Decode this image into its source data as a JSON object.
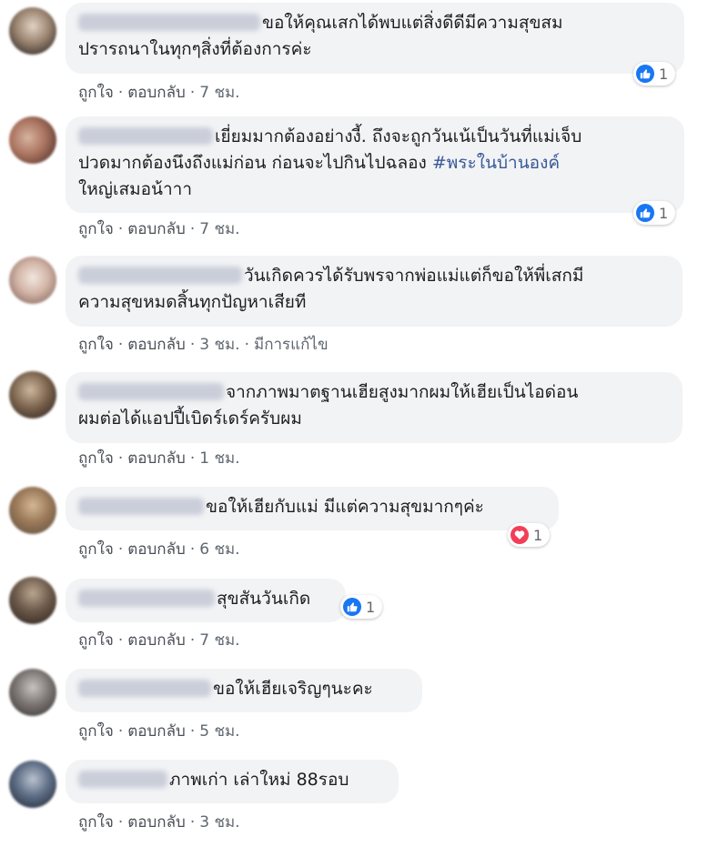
{
  "comments": [
    {
      "name_blur_width": 200,
      "text_lines": [
        "ขอให้คุณเสกได้พบแต่สิ่งดีดีมีความสุขสม",
        "ปรารถนาในทุกๆสิ่งที่ต้องการค่ะ"
      ],
      "like": "ถูกใจ",
      "reply": "ตอบกลับ",
      "time": "7 ชม.",
      "reaction": {
        "type": "like",
        "count": "1"
      }
    },
    {
      "text_lines": [
        "เยี่ยมมากต้องอย่างงี้. ถึงจะถูกวันเน้เป็นวันที่แม่เจ็บ",
        "ปวดมากต้องนึงถึงแม่ก่อน ก่อนจะไปกินไปฉลอง ",
        "ใหญ่เสมอน้าาา"
      ],
      "hashtag": "#พระในบ้านองค์",
      "like": "ถูกใจ",
      "reply": "ตอบกลับ",
      "time": "7 ชม.",
      "reaction": {
        "type": "like",
        "count": "1"
      }
    },
    {
      "text_lines": [
        "วันเกิดควรได้รับพรจากพ่อแม่แต่ก็ขอให้พี่เสกมี",
        "ความสุขหมดสิ้นทุกปัญหาเสียที"
      ],
      "like": "ถูกใจ",
      "reply": "ตอบกลับ",
      "time": "3 ชม.",
      "edited": "มีการแก้ไข"
    },
    {
      "text_lines": [
        "จากภาพมาตฐานเฮียสูงมากผมให้เฮียเป็นไอด่อน",
        "ผมต่อได้แอปปี้เบิดร์เดร์ครับผม"
      ],
      "like": "ถูกใจ",
      "reply": "ตอบกลับ",
      "time": "1 ชม."
    },
    {
      "text_lines": [
        "ขอให้เฮียกับแม่ มีแต่ความสุขมากๆค่ะ"
      ],
      "like": "ถูกใจ",
      "reply": "ตอบกลับ",
      "time": "6 ชม.",
      "reaction": {
        "type": "love",
        "count": "1"
      }
    },
    {
      "text_lines": [
        "สุขสันวันเกิด"
      ],
      "like": "ถูกใจ",
      "reply": "ตอบกลับ",
      "time": "7 ชม.",
      "reaction": {
        "type": "like",
        "count": "1"
      }
    },
    {
      "text_lines": [
        "ขอให้เฮียเจริญๆนะคะ"
      ],
      "like": "ถูกใจ",
      "reply": "ตอบกลับ",
      "time": "5 ชม."
    },
    {
      "text_lines": [
        "ภาพเก่า เล่าใหม่ 88รอบ"
      ],
      "like": "ถูกใจ",
      "reply": "ตอบกลับ",
      "time": "3 ชม."
    }
  ],
  "separator": "·",
  "colors": {
    "bubble": "#f2f3f5",
    "like_blue": "#1877f2",
    "love_red": "#f33e58",
    "link_text": "#606770",
    "hashtag": "#385898"
  },
  "icons": {
    "like": "thumbs-up-icon",
    "love": "heart-icon"
  }
}
